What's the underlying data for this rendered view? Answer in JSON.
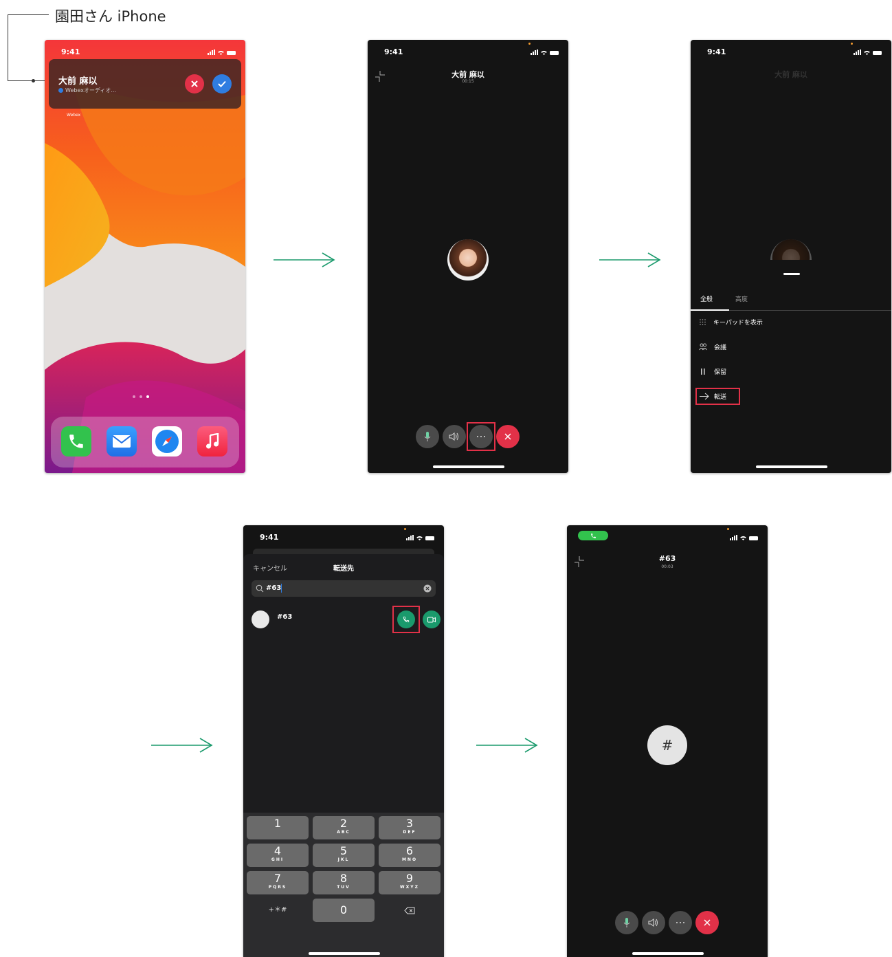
{
  "caption": "園田さん iPhone",
  "colors": {
    "accent_green": "#1a9a6c",
    "decline_red": "#e23148",
    "accept_blue": "#2f7de1",
    "highlight": "#e23148"
  },
  "status": {
    "time": "9:41"
  },
  "screen1": {
    "notification": {
      "caller": "大前 麻以",
      "app_line": "Webexオーディオ...",
      "decline_icon": "close-icon",
      "accept_icon": "check-icon"
    },
    "app_label": "Webex",
    "dock": [
      "phone-app-icon",
      "mail-app-icon",
      "safari-app-icon",
      "music-app-icon"
    ]
  },
  "screen2": {
    "caller": "大前 麻以",
    "duration": "00:15"
  },
  "screen3": {
    "caller": "大前 麻以",
    "tabs": [
      "全般",
      "高度"
    ],
    "menu": [
      {
        "icon": "keypad-icon",
        "label": "キーパッドを表示"
      },
      {
        "icon": "conference-icon",
        "label": "会議"
      },
      {
        "icon": "hold-icon",
        "label": "保留"
      },
      {
        "icon": "transfer-arrow-icon",
        "label": "転送"
      }
    ]
  },
  "screen4": {
    "cancel": "キャンセル",
    "title": "転送先",
    "search_value": "#63",
    "result": "#63",
    "keypad": [
      {
        "n": "1",
        "l": ""
      },
      {
        "n": "2",
        "l": "ABC"
      },
      {
        "n": "3",
        "l": "DEF"
      },
      {
        "n": "4",
        "l": "GHI"
      },
      {
        "n": "5",
        "l": "JKL"
      },
      {
        "n": "6",
        "l": "MNO"
      },
      {
        "n": "7",
        "l": "PQRS"
      },
      {
        "n": "8",
        "l": "TUV"
      },
      {
        "n": "9",
        "l": "WXYZ"
      }
    ],
    "key_symbols": "+＊#",
    "key_zero": "0"
  },
  "screen5": {
    "callee": "#63",
    "duration": "00:03",
    "avatar_glyph": "#"
  }
}
